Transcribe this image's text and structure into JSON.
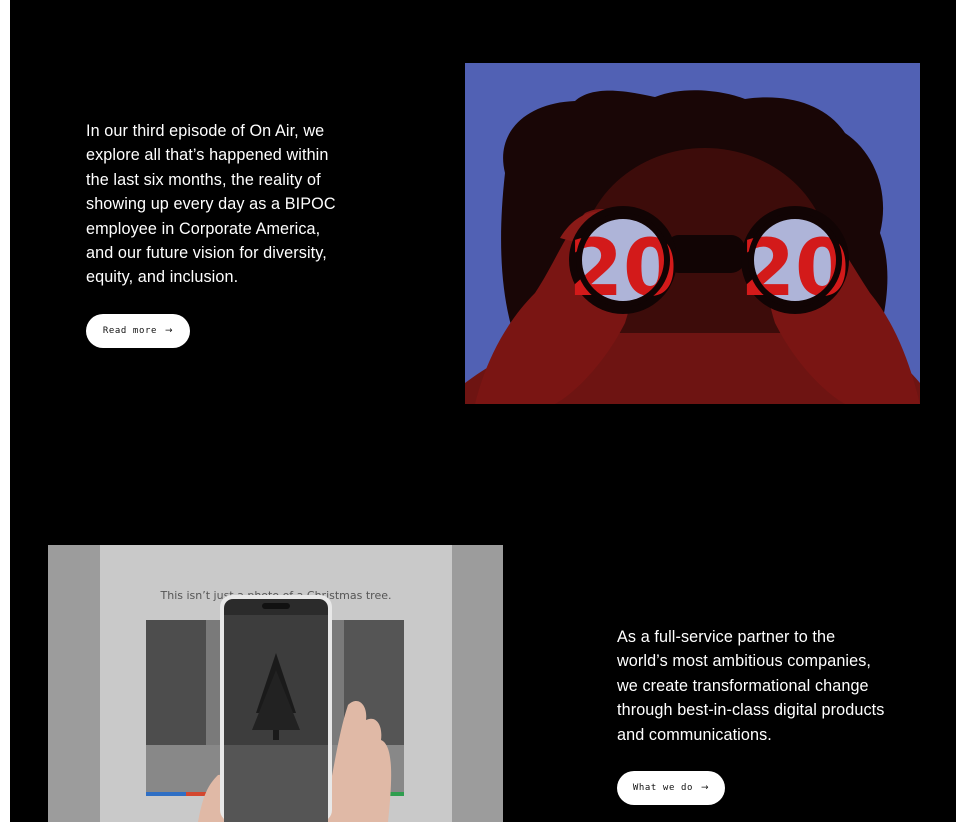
{
  "sections": [
    {
      "description": "In our third episode of On Air, we explore all that’s happened within the last six months, the reality of showing up every day as a BIPOC employee in Corporate America, and our future vision for diversity, equity, and inclusion.",
      "cta_label": "Read more",
      "cta_icon": "arrow-right-icon",
      "image": {
        "lens_left_text": "20",
        "lens_right_text": "20",
        "background_color": "#5161b4",
        "accent_color": "#d31a1a"
      }
    },
    {
      "description": "As a full-service partner to the world’s most ambitious companies, we create transformational change through best-in-class digital products and communications.",
      "cta_label": "What we do",
      "cta_icon": "arrow-right-icon",
      "image": {
        "headline_text": "This isn’t just a photo of a Christmas tree."
      }
    }
  ],
  "colors": {
    "page_background": "#000000",
    "text": "#ffffff",
    "button_background": "#ffffff",
    "button_text": "#111111"
  }
}
